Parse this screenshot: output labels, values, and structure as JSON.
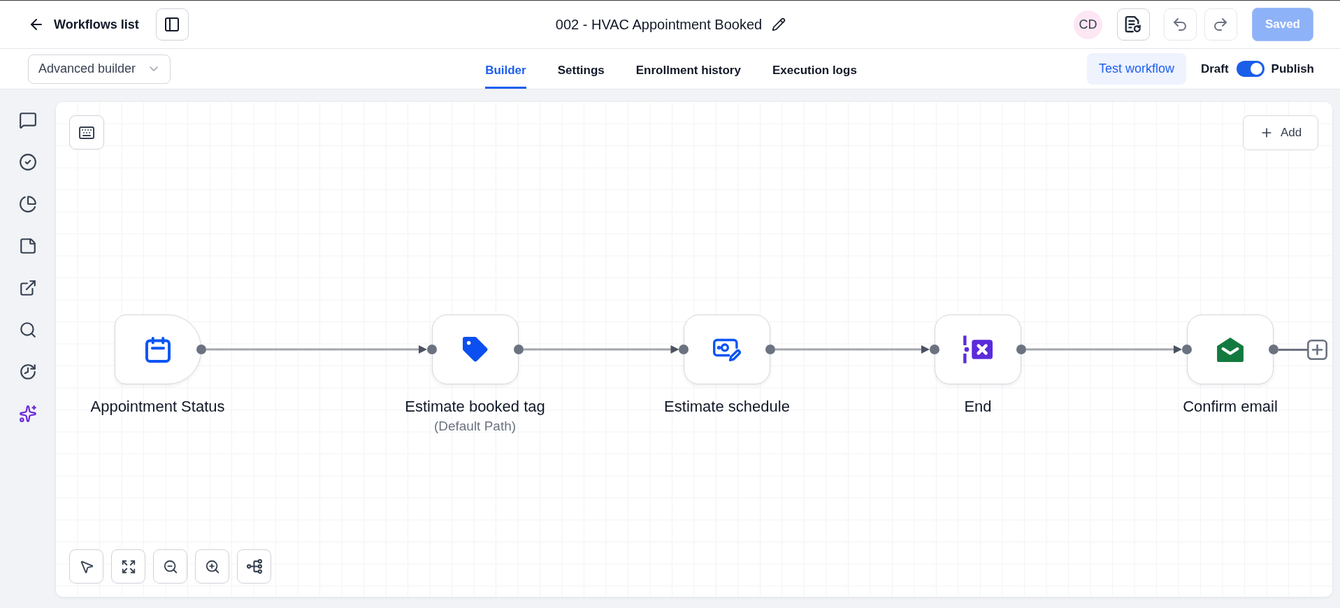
{
  "header": {
    "back_link": "Workflows list",
    "title": "002 - HVAC Appointment Booked",
    "avatar": "CD",
    "save_button": {
      "label": "Saved",
      "disabled": true
    }
  },
  "toolbar": {
    "builder_select": {
      "value": "Advanced builder"
    },
    "tabs": [
      {
        "label": "Builder",
        "selected": true
      },
      {
        "label": "Settings",
        "selected": false
      },
      {
        "label": "Enrollment history",
        "selected": false
      },
      {
        "label": "Execution logs",
        "selected": false
      }
    ],
    "test_button": "Test workflow",
    "publish_toggle": {
      "off_label": "Draft",
      "on_label": "Publish",
      "on": true
    }
  },
  "canvas": {
    "add_button": "Add",
    "nodes": [
      {
        "kind": "trigger",
        "label": "Appointment Status"
      },
      {
        "kind": "tag",
        "label": "Estimate booked tag",
        "note": "(Default Path)"
      },
      {
        "kind": "schedule",
        "label": "Estimate schedule"
      },
      {
        "kind": "end",
        "label": "End"
      },
      {
        "kind": "email",
        "label": "Confirm email"
      }
    ]
  }
}
